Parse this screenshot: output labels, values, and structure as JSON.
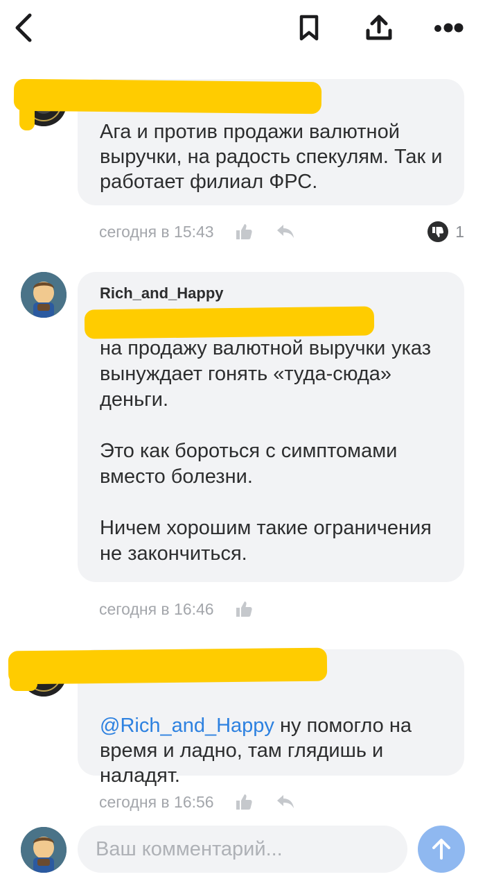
{
  "colors": {
    "accent": "#2d81e0",
    "bubble": "#f2f3f5",
    "redaction": "#ffcc00",
    "send_button": "#8fb8f0",
    "meta_text": "#a3a6ab"
  },
  "toolbar": {
    "back_icon": "chevron-left-icon",
    "bookmark_icon": "bookmark-icon",
    "share_icon": "share-upload-icon",
    "more_icon": "more-dots-icon"
  },
  "comments": [
    {
      "author": "",
      "author_redacted": true,
      "text": "Ага и против продажи валютной выручки, на радость спекулям. Так и работает филиал ФРС.",
      "time": "сегодня в 15:43",
      "dislikes": "1"
    },
    {
      "author": "Rich_and_Happy",
      "mention_redacted": true,
      "first_line_tail": "указ",
      "text": "на продажу валютной выручки вынуждает гонять «туда-сюда» деньги.\n\nЭто как бороться с симптомами вместо болезни.\n\nНичем хорошим такие ограничения не закончиться.",
      "time": "сегодня в 16:46"
    },
    {
      "author": "",
      "author_redacted": true,
      "mention": "@Rich_and_Happy",
      "text": " ну помогло на время и ладно, там глядишь и наладят.",
      "time": "сегодня в 16:56"
    }
  ],
  "composer": {
    "placeholder": "Ваш комментарий..."
  }
}
